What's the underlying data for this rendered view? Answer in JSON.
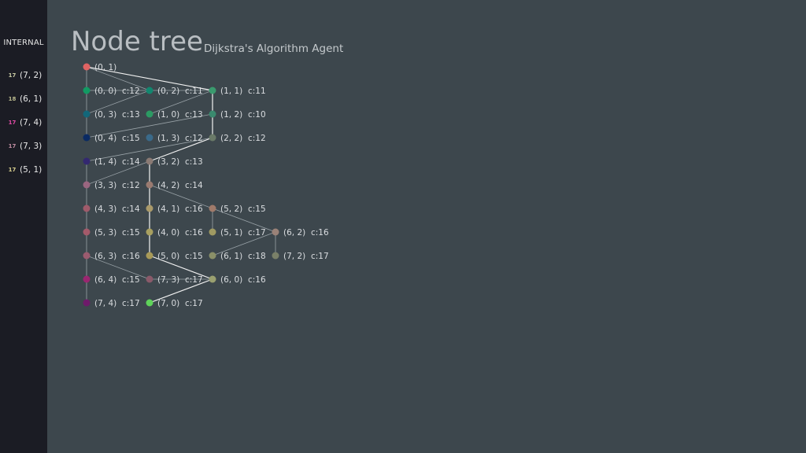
{
  "sidebar": {
    "title": "INTERNAL",
    "items": [
      {
        "label": "(7, 2)",
        "badge": "17",
        "icon": "agent-icon",
        "color": "#c7c9a2"
      },
      {
        "label": "(6, 1)",
        "badge": "18",
        "icon": "agent-icon",
        "color": "#b9b98d"
      },
      {
        "label": "(7, 4)",
        "badge": "17",
        "icon": "agent-icon",
        "color": "#e24aa6"
      },
      {
        "label": "(7, 3)",
        "badge": "17",
        "icon": "agent-icon",
        "color": "#c08da2"
      },
      {
        "label": "(5, 1)",
        "badge": "17",
        "icon": "agent-icon",
        "color": "#d8cf8e"
      }
    ]
  },
  "header": {
    "title": "Node tree",
    "subtitle": "Dijkstra's Algorithm Agent"
  },
  "tree": {
    "nodes": [
      {
        "id": "0_1",
        "label": "(0, 1)",
        "cost": "",
        "col": 0,
        "row": 0,
        "color": "#e06363"
      },
      {
        "id": "0_0",
        "label": "(0, 0)",
        "cost": "c:12",
        "col": 0,
        "row": 1,
        "color": "#129a63"
      },
      {
        "id": "0_3",
        "label": "(0, 3)",
        "cost": "c:13",
        "col": 0,
        "row": 2,
        "color": "#12677a"
      },
      {
        "id": "0_4",
        "label": "(0, 4)",
        "cost": "c:15",
        "col": 0,
        "row": 3,
        "color": "#0a2a63"
      },
      {
        "id": "1_4",
        "label": "(1, 4)",
        "cost": "c:14",
        "col": 0,
        "row": 4,
        "color": "#332870"
      },
      {
        "id": "3_3",
        "label": "(3, 3)",
        "cost": "c:12",
        "col": 0,
        "row": 5,
        "color": "#9a6680"
      },
      {
        "id": "4_3",
        "label": "(4, 3)",
        "cost": "c:14",
        "col": 0,
        "row": 6,
        "color": "#9f5a6a"
      },
      {
        "id": "5_3",
        "label": "(5, 3)",
        "cost": "c:15",
        "col": 0,
        "row": 7,
        "color": "#a35a6a"
      },
      {
        "id": "6_3",
        "label": "(6, 3)",
        "cost": "c:16",
        "col": 0,
        "row": 8,
        "color": "#9b5b6f"
      },
      {
        "id": "6_4",
        "label": "(6, 4)",
        "cost": "c:15",
        "col": 0,
        "row": 9,
        "color": "#9a2670"
      },
      {
        "id": "7_4",
        "label": "(7, 4)",
        "cost": "c:17",
        "col": 0,
        "row": 10,
        "color": "#6e1a6a"
      },
      {
        "id": "0_2",
        "label": "(0, 2)",
        "cost": "c:11",
        "col": 1,
        "row": 1,
        "color": "#12876f"
      },
      {
        "id": "1_0",
        "label": "(1, 0)",
        "cost": "c:13",
        "col": 1,
        "row": 2,
        "color": "#2b9a63"
      },
      {
        "id": "1_3",
        "label": "(1, 3)",
        "cost": "c:12",
        "col": 1,
        "row": 3,
        "color": "#3a6a8a"
      },
      {
        "id": "3_2",
        "label": "(3, 2)",
        "cost": "c:13",
        "col": 1,
        "row": 4,
        "color": "#8a7a74"
      },
      {
        "id": "4_2",
        "label": "(4, 2)",
        "cost": "c:14",
        "col": 1,
        "row": 5,
        "color": "#9a7a70"
      },
      {
        "id": "4_1",
        "label": "(4, 1)",
        "cost": "c:16",
        "col": 1,
        "row": 6,
        "color": "#aa9a6a"
      },
      {
        "id": "4_0",
        "label": "(4, 0)",
        "cost": "c:16",
        "col": 1,
        "row": 7,
        "color": "#a8a060"
      },
      {
        "id": "5_0",
        "label": "(5, 0)",
        "cost": "c:15",
        "col": 1,
        "row": 8,
        "color": "#a89a58"
      },
      {
        "id": "7_3",
        "label": "(7, 3)",
        "cost": "c:17",
        "col": 1,
        "row": 9,
        "color": "#8a5a6a"
      },
      {
        "id": "7_0",
        "label": "(7, 0)",
        "cost": "c:17",
        "col": 1,
        "row": 10,
        "color": "#5fd35a"
      },
      {
        "id": "1_1",
        "label": "(1, 1)",
        "cost": "c:11",
        "col": 2,
        "row": 1,
        "color": "#3a9a6e"
      },
      {
        "id": "1_2",
        "label": "(1, 2)",
        "cost": "c:10",
        "col": 2,
        "row": 2,
        "color": "#3a8a6e"
      },
      {
        "id": "2_2",
        "label": "(2, 2)",
        "cost": "c:12",
        "col": 2,
        "row": 3,
        "color": "#6a7a68"
      },
      {
        "id": "5_2",
        "label": "(5, 2)",
        "cost": "c:15",
        "col": 2,
        "row": 6,
        "color": "#a07a6a"
      },
      {
        "id": "5_1",
        "label": "(5, 1)",
        "cost": "c:17",
        "col": 2,
        "row": 7,
        "color": "#a09a62"
      },
      {
        "id": "6_1",
        "label": "(6, 1)",
        "cost": "c:18",
        "col": 2,
        "row": 8,
        "color": "#8a9068"
      },
      {
        "id": "6_0",
        "label": "(6, 0)",
        "cost": "c:16",
        "col": 2,
        "row": 9,
        "color": "#9aa070"
      },
      {
        "id": "6_2",
        "label": "(6, 2)",
        "cost": "c:16",
        "col": 3,
        "row": 7,
        "color": "#9a8278"
      },
      {
        "id": "7_2",
        "label": "(7, 2)",
        "cost": "c:17",
        "col": 3,
        "row": 8,
        "color": "#7a8068"
      }
    ],
    "edges": [
      {
        "from": "0_1",
        "to": "0_0",
        "path": false
      },
      {
        "from": "0_0",
        "to": "0_3",
        "path": false
      },
      {
        "from": "0_3",
        "to": "0_4",
        "path": false
      },
      {
        "from": "1_4",
        "to": "3_3",
        "path": false
      },
      {
        "from": "3_3",
        "to": "4_3",
        "path": false
      },
      {
        "from": "4_3",
        "to": "5_3",
        "path": false
      },
      {
        "from": "5_3",
        "to": "6_3",
        "path": false
      },
      {
        "from": "6_3",
        "to": "6_4",
        "path": false
      },
      {
        "from": "6_4",
        "to": "7_4",
        "path": false
      },
      {
        "from": "0_1",
        "to": "0_2",
        "path": false
      },
      {
        "from": "0_0",
        "to": "0_2",
        "path": false
      },
      {
        "from": "0_3",
        "to": "0_2",
        "path": false
      },
      {
        "from": "0_2",
        "to": "1_1",
        "path": false
      },
      {
        "from": "1_0",
        "to": "1_1",
        "path": false
      },
      {
        "from": "0_4",
        "to": "1_2",
        "path": false
      },
      {
        "from": "1_4",
        "to": "2_2",
        "path": false
      },
      {
        "from": "3_3",
        "to": "3_2",
        "path": false
      },
      {
        "from": "4_2",
        "to": "5_2",
        "path": false
      },
      {
        "from": "5_2",
        "to": "5_1",
        "path": false
      },
      {
        "from": "5_2",
        "to": "6_2",
        "path": false
      },
      {
        "from": "6_1",
        "to": "6_2",
        "path": false
      },
      {
        "from": "6_2",
        "to": "7_2",
        "path": false
      },
      {
        "from": "6_3",
        "to": "7_3",
        "path": false
      },
      {
        "from": "7_3",
        "to": "6_0",
        "path": false
      },
      {
        "from": "0_1",
        "to": "1_1",
        "path": true
      },
      {
        "from": "1_1",
        "to": "1_2",
        "path": true
      },
      {
        "from": "1_2",
        "to": "2_2",
        "path": true
      },
      {
        "from": "2_2",
        "to": "3_2",
        "path": true
      },
      {
        "from": "3_2",
        "to": "4_2",
        "path": true
      },
      {
        "from": "4_2",
        "to": "4_1",
        "path": true
      },
      {
        "from": "4_1",
        "to": "4_0",
        "path": true
      },
      {
        "from": "4_0",
        "to": "5_0",
        "path": true
      },
      {
        "from": "5_0",
        "to": "6_0",
        "path": true
      },
      {
        "from": "6_0",
        "to": "7_0",
        "path": true
      }
    ],
    "colors": {
      "edge": "#9aa3a8",
      "path_edge": "#f2f2f2"
    }
  }
}
